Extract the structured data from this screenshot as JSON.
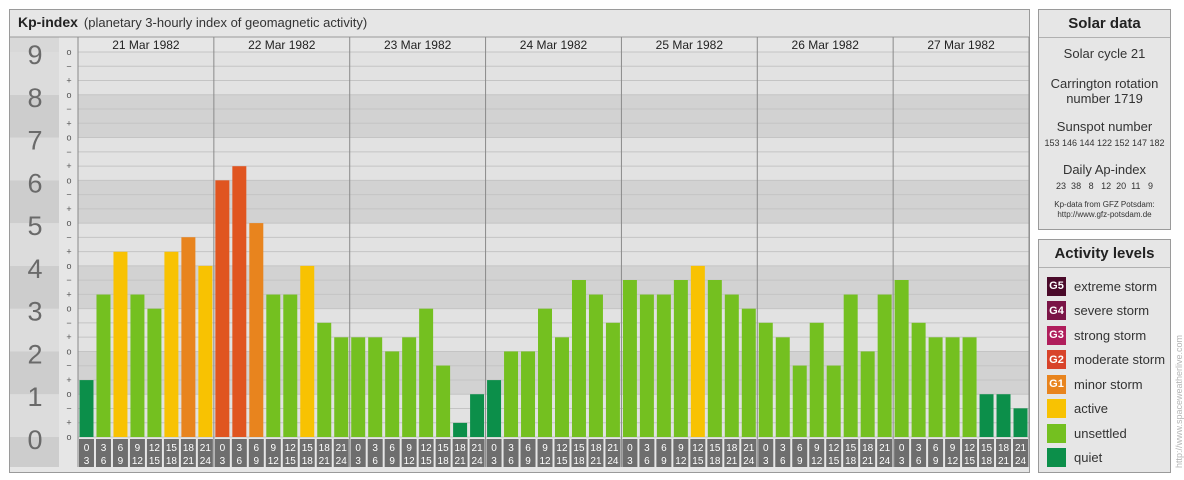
{
  "header": {
    "title": "Kp-index",
    "subtitle": "(planetary 3-hourly index of geomagnetic activity)"
  },
  "chart_data": {
    "type": "bar",
    "title": "Kp-index",
    "subtitle": "(planetary 3-hourly index of geomagnetic activity)",
    "ylim": [
      0,
      9
    ],
    "y_ticks": [
      "0",
      "1",
      "2",
      "3",
      "4",
      "5",
      "6",
      "7",
      "8",
      "9"
    ],
    "y_minor_ticks": [
      "o",
      "+",
      "−"
    ],
    "days": [
      "21 Mar 1982",
      "22 Mar 1982",
      "23 Mar 1982",
      "24 Mar 1982",
      "25 Mar 1982",
      "26 Mar 1982",
      "27 Mar 1982"
    ],
    "interval_labels": [
      [
        "0",
        "3"
      ],
      [
        "3",
        "6"
      ],
      [
        "6",
        "9"
      ],
      [
        "9",
        "12"
      ],
      [
        "12",
        "15"
      ],
      [
        "15",
        "18"
      ],
      [
        "18",
        "21"
      ],
      [
        "21",
        "24"
      ]
    ],
    "values": [
      1.33,
      3.33,
      4.33,
      3.33,
      3.0,
      4.33,
      4.67,
      4.0,
      6.0,
      6.33,
      5.0,
      3.33,
      3.33,
      4.0,
      2.67,
      2.33,
      2.33,
      2.33,
      2.0,
      2.33,
      3.0,
      1.67,
      0.33,
      1.0,
      1.33,
      2.0,
      2.0,
      3.0,
      2.33,
      3.67,
      3.33,
      2.67,
      3.67,
      3.33,
      3.33,
      3.67,
      4.0,
      3.67,
      3.33,
      3.0,
      2.67,
      2.33,
      1.67,
      2.67,
      1.67,
      3.33,
      2.0,
      3.33,
      3.67,
      2.67,
      2.33,
      2.33,
      2.33,
      1.0,
      1.0,
      0.67
    ],
    "colors": {
      "quiet": "#0c8f4a",
      "unsettled": "#74c020",
      "active": "#f8c202",
      "g1": "#e8841e",
      "g2": "#e05520",
      "g3": "#d02a1c"
    }
  },
  "solar": {
    "title": "Solar data",
    "cycle": "Solar cycle 21",
    "carrington_line1": "Carrington rotation",
    "carrington_line2": "number 1719",
    "sunspot_title": "Sunspot number",
    "sunspot_values": "153 146 144 122 152 147 182",
    "ap_title": "Daily Ap-index",
    "ap_values": "23  38   8   12  20  11   9",
    "credit_line1": "Kp-data from GFZ Potsdam:",
    "credit_line2": "http://www.gfz-potsdam.de"
  },
  "activity": {
    "title": "Activity levels",
    "items": [
      {
        "badge": "G5",
        "label": "extreme storm",
        "color": "#4a0a2a"
      },
      {
        "badge": "G4",
        "label": "severe storm",
        "color": "#7a1446"
      },
      {
        "badge": "G3",
        "label": "strong storm",
        "color": "#b01e5c"
      },
      {
        "badge": "G2",
        "label": "moderate storm",
        "color": "#d8432a"
      },
      {
        "badge": "G1",
        "label": "minor storm",
        "color": "#e8841e"
      },
      {
        "badge": "",
        "label": "active",
        "color": "#f8c202"
      },
      {
        "badge": "",
        "label": "unsettled",
        "color": "#74c020"
      },
      {
        "badge": "",
        "label": "quiet",
        "color": "#0c8f4a"
      }
    ]
  },
  "watermark": "http://www.spaceweatherlive.com"
}
